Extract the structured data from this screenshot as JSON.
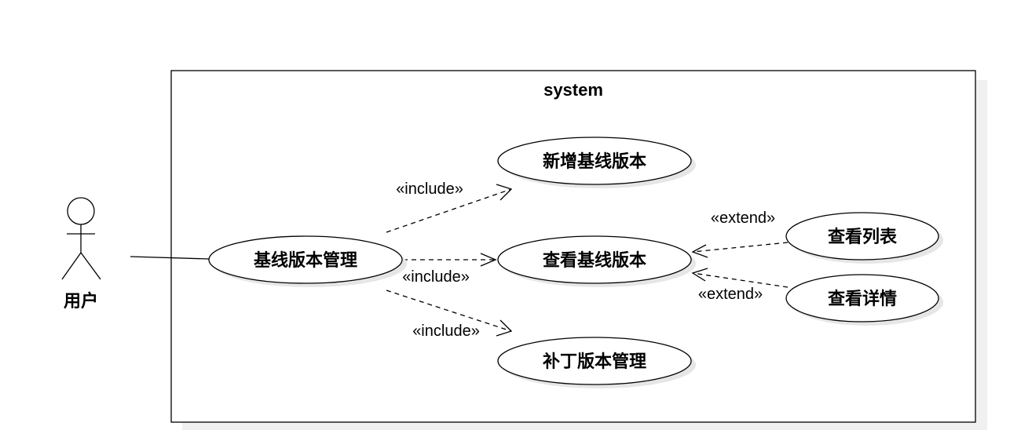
{
  "system": {
    "title": "system"
  },
  "actor": {
    "label": "用户"
  },
  "use_cases": {
    "baseline_mgmt": "基线版本管理",
    "add_baseline": "新增基线版本",
    "view_baseline": "查看基线版本",
    "patch_mgmt": "补丁版本管理",
    "view_list": "查看列表",
    "view_detail": "查看详情"
  },
  "relations": {
    "include_add": "«include»",
    "include_view": "«include»",
    "include_patch": "«include»",
    "extend_list": "«extend»",
    "extend_detail": "«extend»"
  }
}
